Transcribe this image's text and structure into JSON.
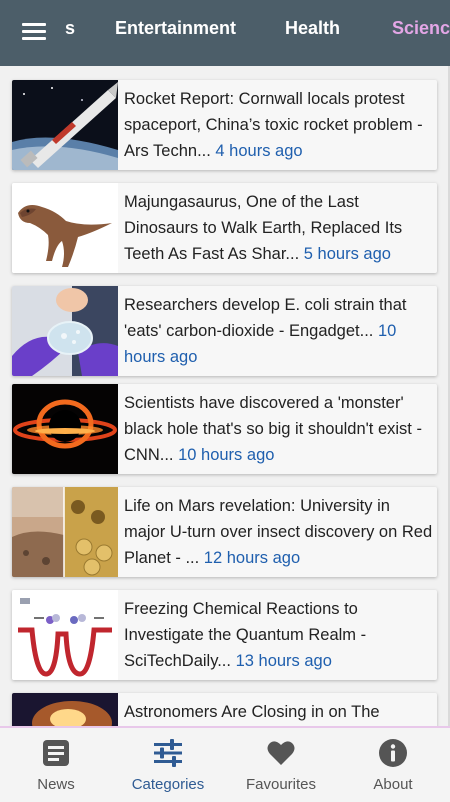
{
  "categories": {
    "items": [
      {
        "label": "s"
      },
      {
        "label": "Entertainment"
      },
      {
        "label": "Health"
      },
      {
        "label": "Science"
      }
    ],
    "active_index": 3
  },
  "articles": [
    {
      "headline": "Rocket Report: Cornwall locals protest spaceport, China’s toxic rocket problem - Ars Techn...",
      "time": "4 hours ago",
      "thumb_icon": "rocket-image"
    },
    {
      "headline": "Majungasaurus, One of the Last Dinosaurs to Walk Earth, Replaced Its Teeth As Fast As Shar...",
      "time": "5 hours ago",
      "thumb_icon": "dinosaur-image"
    },
    {
      "headline": "Researchers develop E. coli strain that 'eats' carbon-dioxide - Engadget...",
      "time": "10 hours ago",
      "thumb_icon": "petri-dish-image"
    },
    {
      "headline": "Scientists have discovered a 'monster' black hole that's so big it shouldn't exist - CNN...",
      "time": "10 hours ago",
      "thumb_icon": "black-hole-image"
    },
    {
      "headline": "Life on Mars revelation: University in major U-turn over insect discovery on Red Planet - ...",
      "time": "12 hours ago",
      "thumb_icon": "mars-bees-image"
    },
    {
      "headline": "Freezing Chemical Reactions to Investigate the Quantum Realm - SciTechDaily...",
      "time": "13 hours ago",
      "thumb_icon": "quantum-diagram-image"
    },
    {
      "headline": "Astronomers Are Closing in on The",
      "time": "",
      "thumb_icon": "galaxy-image"
    }
  ],
  "bottom_nav": {
    "items": [
      {
        "label": "News",
        "icon": "news-icon"
      },
      {
        "label": "Categories",
        "icon": "sliders-icon"
      },
      {
        "label": "Favourites",
        "icon": "heart-icon"
      },
      {
        "label": "About",
        "icon": "info-icon"
      }
    ],
    "active_index": 1
  },
  "colors": {
    "top_bar": "#4c5e69",
    "active_tab": "#e3a6e6",
    "time_link": "#1f5fae",
    "active_nav": "#2f5b93"
  }
}
